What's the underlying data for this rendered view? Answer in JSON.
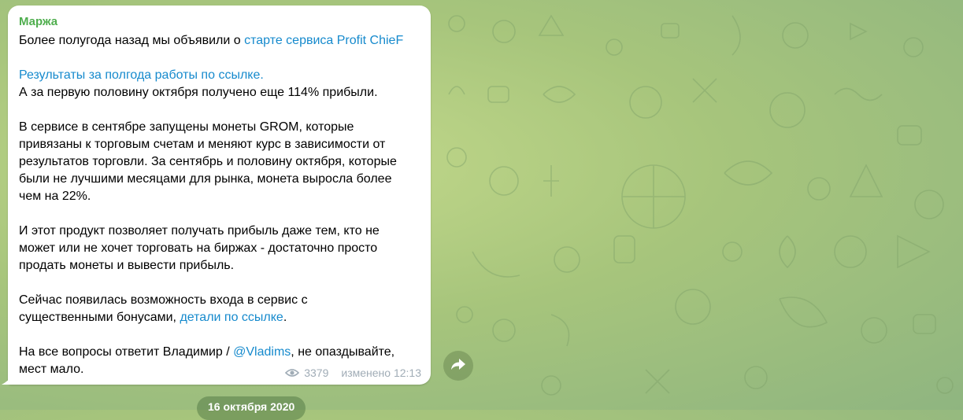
{
  "post": {
    "sender": "Маржа",
    "p1_prefix": "Более полугода назад мы объявили о ",
    "p1_link": "старте сервиса Profit ChieF",
    "p2_link": "Результаты за полгода работы по ссылке.",
    "p2_text": "А за первую половину октября получено еще 114% прибыли.",
    "p3_lines": [
      "В сервисе в сентябре запущены монеты GROM, которые",
      "привязаны к торговым счетам и меняют курс в зависимости от",
      "результатов торговли. За сентябрь и половину октября, которые",
      "были не лучшими месяцами для рынка, монета выросла более",
      "чем на 22%."
    ],
    "p4_lines": [
      "И этот продукт позволяет получать прибыль даже тем, кто не",
      "может или не хочет торговать на биржах - достаточно просто",
      "продать монеты и вывести прибыль."
    ],
    "p5_line1": "Сейчас появилась возможность входа в сервис с",
    "p5_prefix": "существенными бонусами, ",
    "p5_link": "детали по ссылке",
    "p5_suffix": ".",
    "p6_prefix": "На все вопросы ответит Владимир / ",
    "p6_mention": "@Vladims",
    "p6_suffix": ", не опаздывайте,",
    "p6_line2": "мест мало.",
    "views": "3379",
    "edited_time": "изменено 12:13",
    "icons": {
      "views": "eye-icon",
      "share": "share-arrow-icon"
    }
  },
  "date_badge": "16 октября 2020",
  "colors": {
    "sender": "#4fae4e",
    "link": "#168acd",
    "meta": "#a0acb6"
  }
}
